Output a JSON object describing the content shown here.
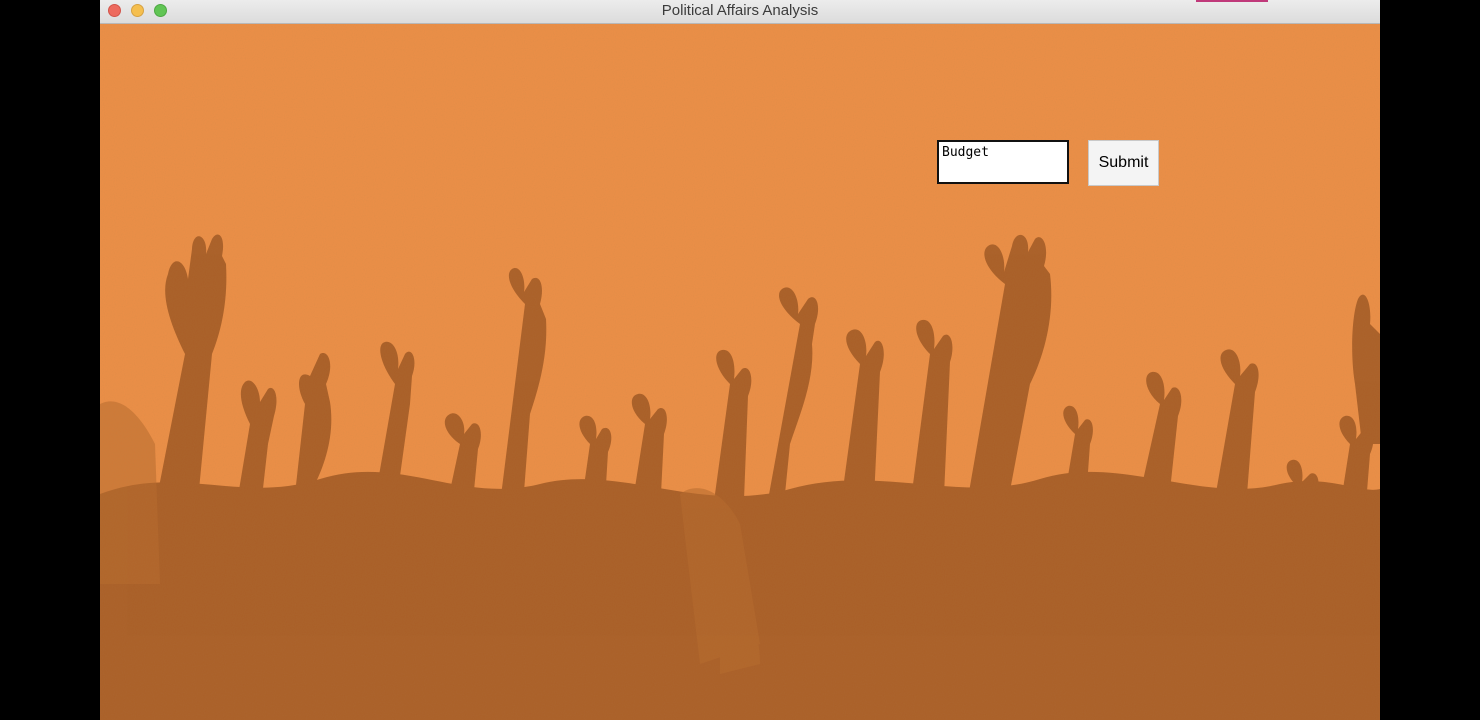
{
  "window": {
    "title": "Political Affairs Analysis",
    "traffic_lights": [
      "close-button",
      "minimize-button",
      "zoom-button"
    ]
  },
  "background": {
    "description_icon": "raised-hands-crowd-image",
    "color_sky": "#ee8f46",
    "color_silhouette": "#a85d25"
  },
  "form": {
    "input_value": "Budget",
    "submit_label": "Submit"
  }
}
